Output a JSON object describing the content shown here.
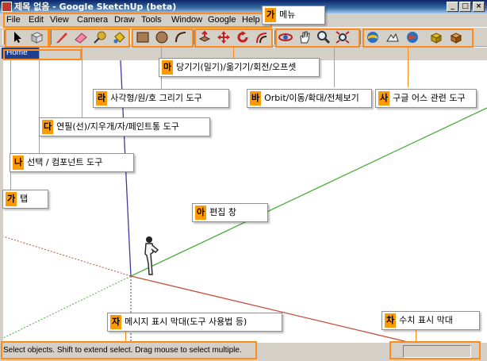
{
  "window": {
    "title": "제목 없음 - Google SketchUp (beta)",
    "min": "_",
    "max": "□",
    "close": "×"
  },
  "menu": [
    "File",
    "Edit",
    "View",
    "Camera",
    "Draw",
    "Tools",
    "Window",
    "Google",
    "Help"
  ],
  "tab": {
    "home": "Home"
  },
  "status": {
    "message": "Select objects. Shift to extend select. Drag mouse to select multiple."
  },
  "callouts": {
    "menu": {
      "badge": "가",
      "text": "메뉴"
    },
    "tab": {
      "badge": "가",
      "text": "탭"
    },
    "select": {
      "badge": "나",
      "text": "선택 / 컴포넌트 도구"
    },
    "pencil": {
      "badge": "다",
      "text": "연필(선)/지우개/자/페인트통 도구"
    },
    "shape": {
      "badge": "라",
      "text": "사각형/원/호 그리기 도구"
    },
    "modify": {
      "badge": "마",
      "text": "당기기(밀기)/옮기기/회전/오프셋"
    },
    "camera": {
      "badge": "바",
      "text": "Orbit/이동/확대/전체보기"
    },
    "google": {
      "badge": "사",
      "text": "구글 어스 관련 도구"
    },
    "edit": {
      "badge": "아",
      "text": "편집 창"
    },
    "statusbar": {
      "badge": "자",
      "text": "메시지 표시 막대(도구 사용법 등)"
    },
    "vcb": {
      "badge": "차",
      "text": "수치 표시 막대"
    }
  },
  "colors": {
    "highlight": "#ff8c1a",
    "badge": "#ff9900",
    "red_axis": "#c0503c",
    "green_axis": "#4caf3c",
    "blue_axis": "#3c3ca0"
  }
}
